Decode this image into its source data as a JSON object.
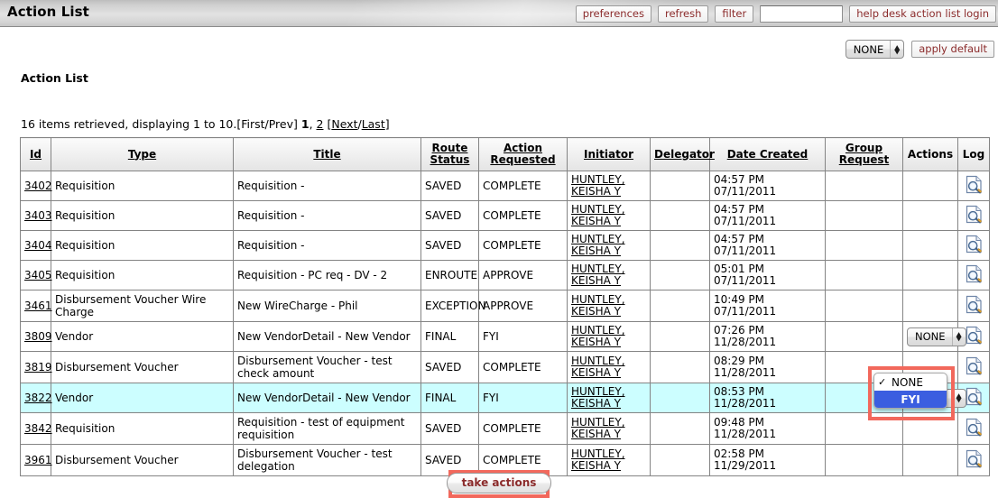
{
  "window": {
    "title": "Action List"
  },
  "toolbar": {
    "preferences_label": "preferences",
    "refresh_label": "refresh",
    "filter_label": "filter",
    "search_value": "",
    "search_placeholder": "",
    "help_desk_label": "help desk action list login"
  },
  "default_row": {
    "select_value": "NONE",
    "apply_default_label": "apply default"
  },
  "page": {
    "heading": "Action List",
    "retrieval_prefix": "16 items retrieved, displaying 1 to 10.[First/Prev] ",
    "current_page": "1",
    "separator": ", ",
    "page_2": "2",
    "next_last_open": " [",
    "next_label": "Next",
    "slash": "/",
    "last_label": "Last",
    "next_last_close": "]"
  },
  "table": {
    "columns": [
      {
        "label": "Id",
        "sortable": true
      },
      {
        "label": "Type",
        "sortable": true
      },
      {
        "label": "Title",
        "sortable": true
      },
      {
        "label": "Route Status",
        "sortable": true
      },
      {
        "label": "Action Requested",
        "sortable": true
      },
      {
        "label": "Initiator",
        "sortable": true
      },
      {
        "label": "Delegator",
        "sortable": true
      },
      {
        "label": "Date Created",
        "sortable": true
      },
      {
        "label": "Group Request",
        "sortable": true
      },
      {
        "label": "Actions",
        "sortable": false
      },
      {
        "label": "Log",
        "sortable": false
      }
    ],
    "rows": [
      {
        "id": "3402",
        "type": "Requisition",
        "title": "Requisition -",
        "route_status": "SAVED",
        "action_requested": "COMPLETE",
        "initiator": "HUNTLEY, KEISHA Y",
        "delegator": "",
        "date_created": "04:57 PM\n07/11/2011",
        "group_request": "",
        "action_select": null,
        "selected": false
      },
      {
        "id": "3403",
        "type": "Requisition",
        "title": "Requisition -",
        "route_status": "SAVED",
        "action_requested": "COMPLETE",
        "initiator": "HUNTLEY, KEISHA Y",
        "delegator": "",
        "date_created": "04:57 PM\n07/11/2011",
        "group_request": "",
        "action_select": null,
        "selected": false
      },
      {
        "id": "3404",
        "type": "Requisition",
        "title": "Requisition -",
        "route_status": "SAVED",
        "action_requested": "COMPLETE",
        "initiator": "HUNTLEY, KEISHA Y",
        "delegator": "",
        "date_created": "04:57 PM\n07/11/2011",
        "group_request": "",
        "action_select": null,
        "selected": false
      },
      {
        "id": "3405",
        "type": "Requisition",
        "title": "Requisition - PC req - DV - 2",
        "route_status": "ENROUTE",
        "action_requested": "APPROVE",
        "initiator": "HUNTLEY, KEISHA Y",
        "delegator": "",
        "date_created": "05:01 PM\n07/11/2011",
        "group_request": "",
        "action_select": null,
        "selected": false
      },
      {
        "id": "3461",
        "type": "Disbursement Voucher Wire Charge",
        "title": "New WireCharge - Phil",
        "route_status": "EXCEPTION",
        "action_requested": "APPROVE",
        "initiator": "HUNTLEY, KEISHA Y",
        "delegator": "",
        "date_created": "10:49 PM\n07/11/2011",
        "group_request": "",
        "action_select": null,
        "selected": false
      },
      {
        "id": "3809",
        "type": "Vendor",
        "title": "New VendorDetail - New Vendor",
        "route_status": "FINAL",
        "action_requested": "FYI",
        "initiator": "HUNTLEY, KEISHA Y",
        "delegator": "",
        "date_created": "07:26 PM\n11/28/2011",
        "group_request": "",
        "action_select": "NONE",
        "selected": false
      },
      {
        "id": "3819",
        "type": "Disbursement Voucher",
        "title": "Disbursement Voucher - test check amount",
        "route_status": "SAVED",
        "action_requested": "COMPLETE",
        "initiator": "HUNTLEY, KEISHA Y",
        "delegator": "",
        "date_created": "08:29 PM\n11/28/2011",
        "group_request": "",
        "action_select": null,
        "selected": false
      },
      {
        "id": "3822",
        "type": "Vendor",
        "title": "New VendorDetail - New Vendor",
        "route_status": "FINAL",
        "action_requested": "FYI",
        "initiator": "HUNTLEY, KEISHA Y",
        "delegator": "",
        "date_created": "08:53 PM\n11/28/2011",
        "group_request": "",
        "action_select": "NONE",
        "selected": true
      },
      {
        "id": "3842",
        "type": "Requisition",
        "title": "Requisition - test of equipment requisition",
        "route_status": "SAVED",
        "action_requested": "COMPLETE",
        "initiator": "HUNTLEY, KEISHA Y",
        "delegator": "",
        "date_created": "09:48 PM\n11/28/2011",
        "group_request": "",
        "action_select": null,
        "selected": false
      },
      {
        "id": "3961",
        "type": "Disbursement Voucher",
        "title": "Disbursement Voucher - test delegation",
        "route_status": "SAVED",
        "action_requested": "COMPLETE",
        "initiator": "HUNTLEY, KEISHA Y",
        "delegator": "",
        "date_created": "02:58 PM\n11/29/2011",
        "group_request": "",
        "action_select": null,
        "selected": false
      }
    ]
  },
  "dropdown": {
    "open": true,
    "options": [
      {
        "label": "NONE",
        "checked": true,
        "highlighted": false
      },
      {
        "label": "FYI",
        "checked": false,
        "highlighted": true
      }
    ],
    "checkmark": "✓"
  },
  "footer": {
    "take_actions_label": "take actions"
  },
  "colors": {
    "link_red": "#8b2b2b",
    "selected_row": "#ccfeff",
    "highlight_box": "#f2685c",
    "dropdown_selected": "#3b5ee0"
  }
}
